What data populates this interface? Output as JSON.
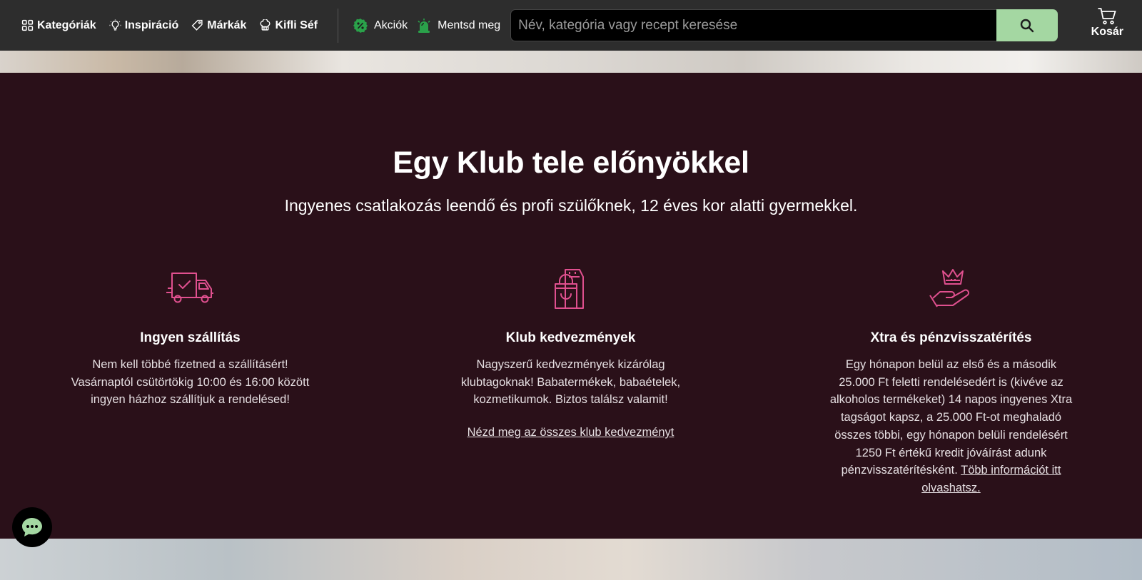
{
  "nav": {
    "categories": "Kategóriák",
    "inspiration": "Inspiráció",
    "brands": "Márkák",
    "chef": "Kifli Séf",
    "deals": "Akciók",
    "save": "Mentsd meg"
  },
  "search": {
    "placeholder": "Név, kategória vagy recept keresése"
  },
  "cart": {
    "label": "Kosár"
  },
  "club": {
    "title": "Egy Klub tele előnyökkel",
    "subtitle": "Ingyenes csatlakozás leendő és profi szülőknek, 12 éves kor alatti gyermekkel.",
    "features": [
      {
        "title": "Ingyen szállítás",
        "text": "Nem kell többé fizetned a szállításért! Vasárnaptól csütörtökig 10:00 és 16:00 között ingyen házhoz szállítjuk a rendelésed!"
      },
      {
        "title": "Klub kedvezmények",
        "text": "Nagyszerű kedvezmények kizárólag klubtagoknak! Babatermékek, babaételek, kozmetikumok. Biztos találsz valamit!",
        "link": "Nézd meg az összes klub kedvezményt"
      },
      {
        "title": "Xtra és pénzvisszatérítés",
        "text": "Egy hónapon belül az első és a második 25.000 Ft feletti rendelésedért is (kivéve az alkoholos termékeket) 14 napos ingyenes Xtra tagságot kapsz, a 25.000 Ft-ot meghaladó összes többi, egy hónapon belüli rendelésért 1250 Ft értékű kredit jóváírást adunk pénzvisszatérítésként.",
        "link": "Több információt itt olvashatsz."
      }
    ]
  },
  "colors": {
    "topbar": "#2d2d2d",
    "club_bg": "#2a1019",
    "accent_pink": "#e0508f",
    "search_button": "#a4d7a2",
    "promo_green": "#2aa14a"
  },
  "icons": {
    "categories": "grid-icon",
    "inspiration": "lightbulb-icon",
    "brands": "tag-icon",
    "chef": "chef-hat-icon",
    "deals": "percent-badge-icon",
    "save": "siren-icon",
    "search": "search-icon",
    "cart": "cart-icon",
    "delivery": "delivery-truck-icon",
    "discounts": "shopping-bags-icon",
    "cashback": "crown-hand-icon",
    "chat": "chat-icon"
  }
}
